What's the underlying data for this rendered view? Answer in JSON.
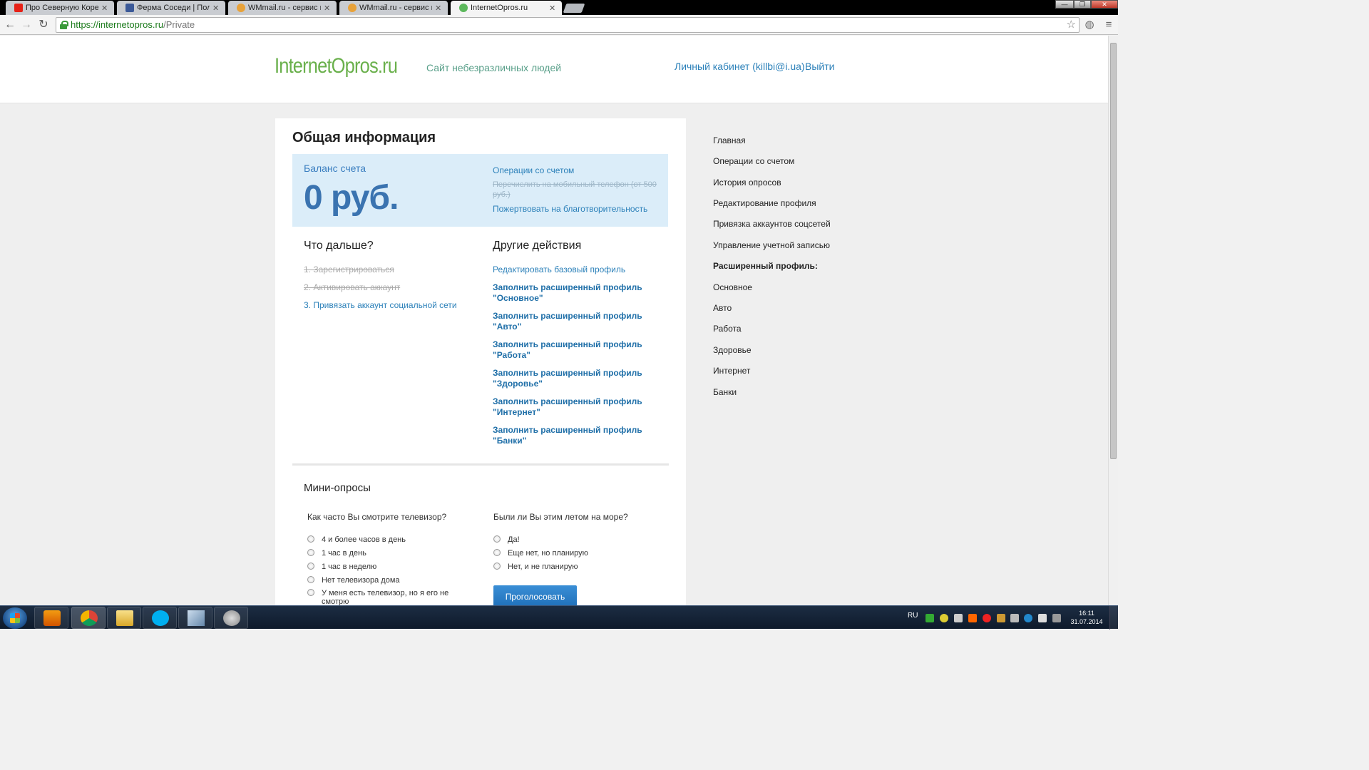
{
  "browser": {
    "tabs": [
      {
        "title": "Про Северную Корею - …",
        "favicon_color": "#e62117"
      },
      {
        "title": "Ферма Соседи | Поле",
        "favicon_color": "#3b5998"
      },
      {
        "title": "WMmail.ru - сервис почт…",
        "favicon_color": "#e8a23a"
      },
      {
        "title": "WMmail.ru - сервис почт…",
        "favicon_color": "#e8a23a"
      },
      {
        "title": "InternetOpros.ru",
        "favicon_color": "#5cb85c"
      }
    ],
    "url_host": "https://internetopros.ru",
    "url_path": "/Private"
  },
  "header": {
    "logo_main": "InternetOpros",
    "logo_tld": ".ru",
    "slogan": "Сайт небезразличных людей",
    "cabinet": "Личный кабинет (killbi@i.ua)",
    "logout": "Выйти"
  },
  "general": {
    "title": "Общая информация",
    "balance_label": "Баланс счета",
    "balance_value": "0 руб.",
    "ops_link": "Операции со счетом",
    "mobile_link": "Перечислить на мобильный телефон (от 500 руб.)",
    "charity_link": "Пожертвовать на благотворительность"
  },
  "next": {
    "title": "Что дальше?",
    "steps": [
      {
        "label": "1. Зарегистрироваться",
        "done": true
      },
      {
        "label": "2. Активировать аккаунт",
        "done": true
      },
      {
        "label": "3. Привязать аккаунт социальной сети",
        "done": false
      }
    ]
  },
  "other": {
    "title": "Другие действия",
    "edit_base": "Редактировать базовый профиль",
    "profiles": [
      "Заполнить расширенный профиль \"Основное\"",
      "Заполнить расширенный профиль \"Авто\"",
      "Заполнить расширенный профиль \"Работа\"",
      "Заполнить расширенный профиль \"Здоровье\"",
      "Заполнить расширенный профиль \"Интернет\"",
      "Заполнить расширенный профиль \"Банки\""
    ]
  },
  "mini": {
    "title": "Мини-опросы",
    "q1": "Как часто Вы смотрите телевизор?",
    "q1_options": [
      "4 и более часов в день",
      "1 час в день",
      "1 час в неделю",
      "Нет телевизора дома",
      "У меня есть телевизор, но я его не смотрю"
    ],
    "q2": "Были ли Вы этим летом на море?",
    "q2_options": [
      "Да!",
      "Еще нет, но планирую",
      "Нет, и не планирую"
    ],
    "vote_button": "Проголосовать"
  },
  "sidenav": [
    {
      "label": "Главная",
      "head": false
    },
    {
      "label": "Операции со счетом",
      "head": false
    },
    {
      "label": "История опросов",
      "head": false
    },
    {
      "label": "Редактирование профиля",
      "head": false
    },
    {
      "label": "Привязка аккаунтов соцсетей",
      "head": false
    },
    {
      "label": "Управление учетной записью",
      "head": false
    },
    {
      "label": "Расширенный профиль:",
      "head": true
    },
    {
      "label": "Основное",
      "head": false
    },
    {
      "label": "Авто",
      "head": false
    },
    {
      "label": "Работа",
      "head": false
    },
    {
      "label": "Здоровье",
      "head": false
    },
    {
      "label": "Интернет",
      "head": false
    },
    {
      "label": "Банки",
      "head": false
    }
  ],
  "taskbar": {
    "lang": "RU",
    "time": "16:11",
    "date": "31.07.2014"
  }
}
